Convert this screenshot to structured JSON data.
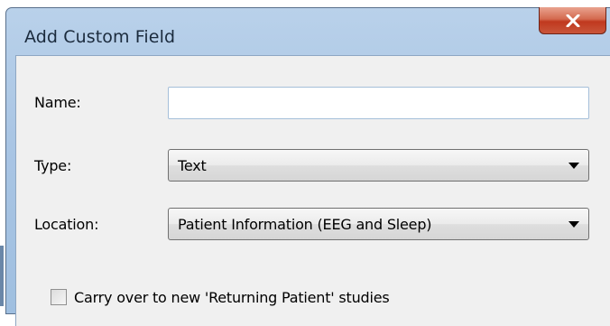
{
  "window": {
    "title": "Add Custom Field"
  },
  "form": {
    "name": {
      "label": "Name:",
      "value": ""
    },
    "type": {
      "label": "Type:",
      "selected": "Text"
    },
    "location": {
      "label": "Location:",
      "selected": "Patient Information (EEG and Sleep)"
    },
    "carry_over": {
      "label": "Carry over to new 'Returning Patient' studies",
      "checked": false
    }
  },
  "icons": {
    "close": "close-icon",
    "dropdown": "chevron-down-icon"
  }
}
